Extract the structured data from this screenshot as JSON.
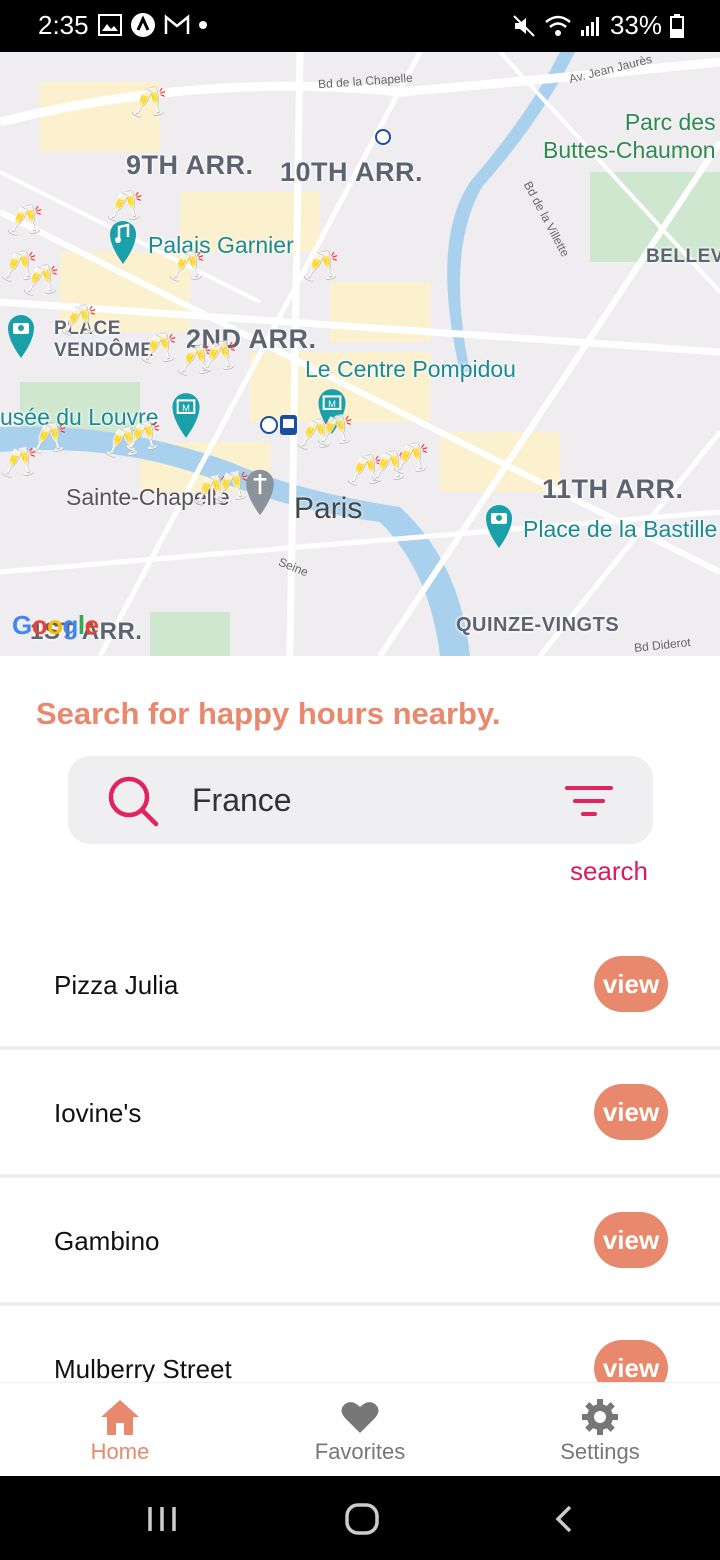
{
  "status_bar": {
    "time": "2:35",
    "battery": "33%"
  },
  "map": {
    "labels": {
      "arr9": "9TH ARR.",
      "arr10": "10TH ARR.",
      "arr2": "2ND ARR.",
      "arr11": "11TH ARR.",
      "arr1": "1ST ARR.",
      "quinze": "QUINZE-VINGTS",
      "belleville": "BELLEV",
      "place_vendome": "PLACE\nVENDÔME",
      "palais_garnier": "Palais Garnier",
      "centre_pompidou": "Le Centre Pompidou",
      "louvre": "usée du Louvre",
      "sainte_chapelle": "Sainte-Chapelle",
      "paris": "Paris",
      "bastille": "Place de la Bastille",
      "buttes_chaumont": "Parc des\nButtes-Chaumon",
      "bd_chapelle": "Bd de la Chapelle",
      "av_jean_jaures": "Av. Jean Jaurès",
      "bd_villette": "Bd de la Villette",
      "seine": "Seine",
      "bd_diderot": "Bd Diderot"
    },
    "google_logo": "Google"
  },
  "search": {
    "headline": "Search for happy hours nearby.",
    "query": "France",
    "search_link": "search"
  },
  "results": [
    {
      "name": "Pizza Julia",
      "action": "view"
    },
    {
      "name": "Iovine's",
      "action": "view"
    },
    {
      "name": "Gambino",
      "action": "view"
    },
    {
      "name": "Mulberry Street",
      "action": "view"
    }
  ],
  "tabs": [
    {
      "label": "Home",
      "icon": "home-icon",
      "active": true
    },
    {
      "label": "Favorites",
      "icon": "heart-icon",
      "active": false
    },
    {
      "label": "Settings",
      "icon": "gear-icon",
      "active": false
    }
  ],
  "colors": {
    "accent": "#e8886c",
    "link": "#d81b60",
    "poi": "#1a8a93"
  }
}
